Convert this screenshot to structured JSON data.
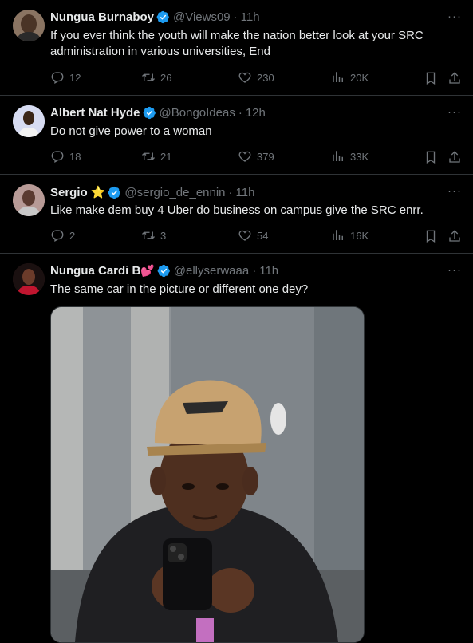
{
  "tweets": [
    {
      "name": "Nungua Burnaboy",
      "handle": "@Views09",
      "time": "11h",
      "text": "If you ever think the youth will make the nation better look at your SRC administration in various universities, End",
      "replies": "12",
      "reposts": "26",
      "likes": "230",
      "views": "20K"
    },
    {
      "name": "Albert Nat Hyde",
      "handle": "@BongoIdeas",
      "time": "12h",
      "text": "Do not give power to a woman",
      "replies": "18",
      "reposts": "21",
      "likes": "379",
      "views": "33K"
    },
    {
      "name": "Sergio",
      "name_emoji": "⭐",
      "handle": "@sergio_de_ennin",
      "time": "11h",
      "text": "Like make dem buy 4 Uber  do business on campus give the SRC enrr.",
      "replies": "2",
      "reposts": "3",
      "likes": "54",
      "views": "16K"
    },
    {
      "name": "Nungua Cardi B",
      "name_emoji": "💕",
      "handle": "@ellyserwaaa",
      "time": "11h",
      "text": "The same car in the picture or different one dey?"
    }
  ],
  "ui": {
    "more": "···",
    "separator": "·"
  },
  "colors": {
    "background": "#000000",
    "text": "#e7e9ea",
    "secondary": "#71767b",
    "verified": "#1d9bf0",
    "border": "#2f3336"
  }
}
